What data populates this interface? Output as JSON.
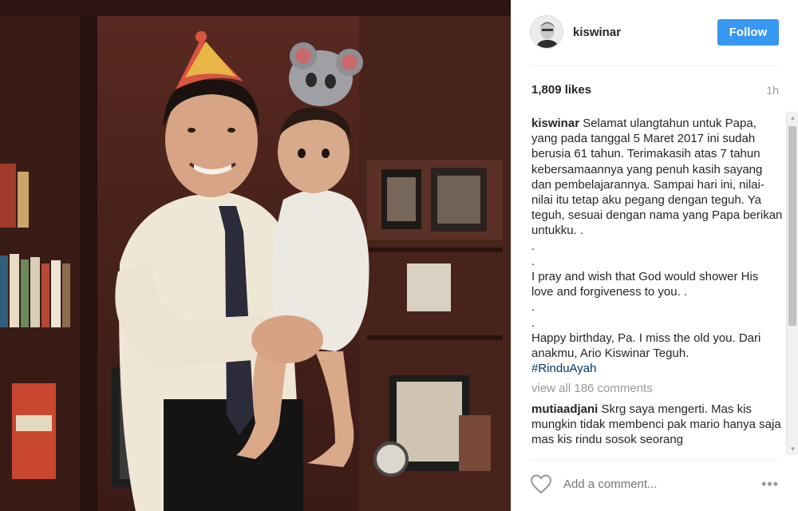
{
  "post": {
    "photo_alt": "photo",
    "author": {
      "username": "kiswinar",
      "follow_label": "Follow"
    },
    "likes": "1,809 likes",
    "time_ago": "1h",
    "caption": {
      "username": "kiswinar",
      "lines": [
        "Selamat ulangtahun untuk Papa, yang pada tanggal 5 Maret 2017 ini sudah berusia 61 tahun. Terimakasih atas 7 tahun kebersamaannya yang penuh kasih sayang dan pembelajarannya. Sampai hari ini, nilai-nilai itu tetap aku pegang dengan teguh. Ya teguh, sesuai dengan nama yang Papa berikan untukku. .",
        ".",
        ".",
        "I pray and wish that God would shower His love and forgiveness to you. .",
        ".",
        ".",
        "Happy birthday, Pa. I miss the old you. Dari anakmu, Ario Kiswinar Teguh."
      ],
      "hashtag": "#RinduAyah"
    },
    "view_all_comments": "view all 186 comments",
    "comments": [
      {
        "username": "mutiaadjani",
        "text": "Skrg saya mengerti. Mas kis mungkin tidak membenci pak mario hanya saja mas kis rindu sosok seorang"
      }
    ],
    "add_comment_placeholder": "Add a comment...",
    "more_label": "•••"
  },
  "colors": {
    "follow_bg": "#3897f0",
    "hashtag": "#003569",
    "muted": "#999999"
  },
  "icons": {
    "like": "heart-outline-icon",
    "more": "ellipsis-icon"
  }
}
